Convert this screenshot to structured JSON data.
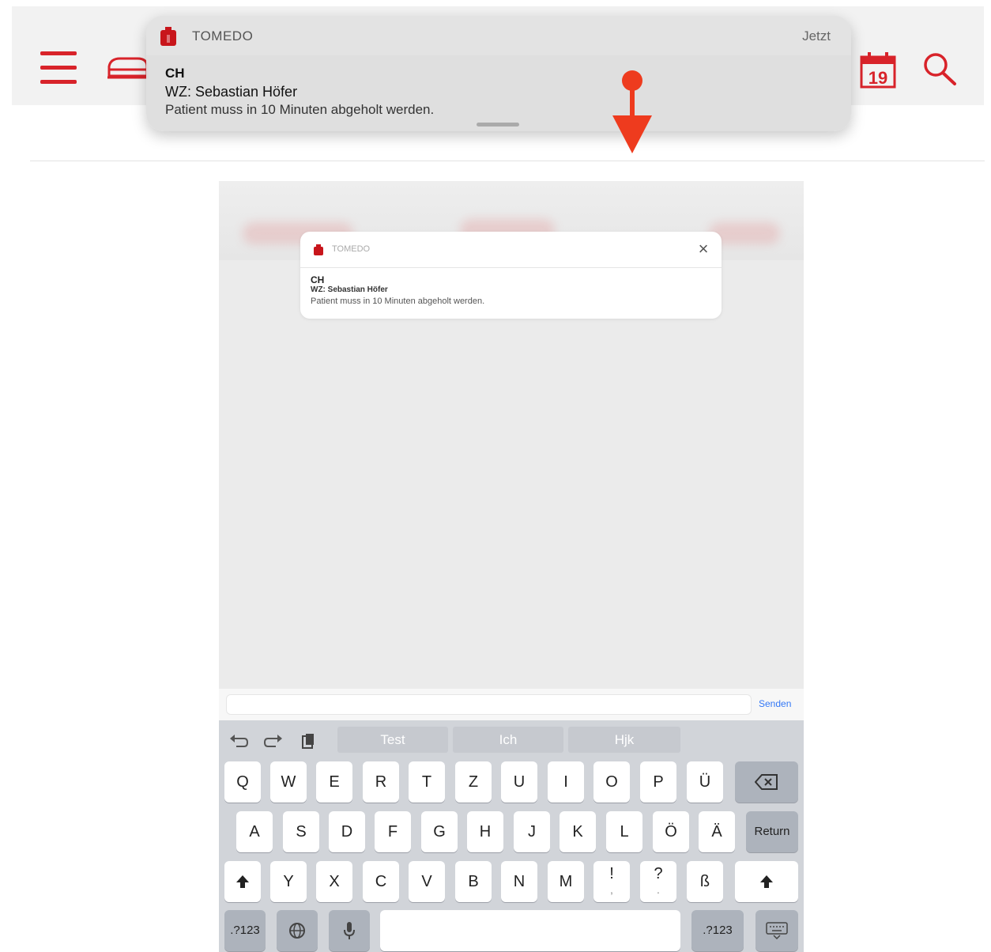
{
  "app_bar": {
    "menu_icon": "hamburger-menu-icon",
    "bed_icon": "bed-icon",
    "calendar_icon": "calendar-icon",
    "calendar_day": "19",
    "search_icon": "search-icon",
    "accent_color": "#d8232a"
  },
  "banner": {
    "app_name": "TOMEDO",
    "time": "Jetzt",
    "title": "CH",
    "subtitle": "WZ: Sebastian Höfer",
    "message": "Patient muss in 10 Minuten abgeholt werden."
  },
  "annotation": {
    "swipe_arrow_icon": "swipe-down-arrow-icon",
    "arrow_color": "#ee3b1e"
  },
  "inner_screen": {
    "notification": {
      "app_name": "TOMEDO",
      "title": "CH",
      "subtitle": "WZ: Sebastian Höfer",
      "message": "Patient muss in 10 Minuten abgeholt werden."
    },
    "compose": {
      "input_value": "",
      "send_label": "Senden"
    },
    "keyboard": {
      "suggestions": [
        "Test",
        "Ich",
        "Hjk"
      ],
      "row1": [
        "Q",
        "W",
        "E",
        "R",
        "T",
        "Z",
        "U",
        "I",
        "O",
        "P",
        "Ü"
      ],
      "row2": [
        "A",
        "S",
        "D",
        "F",
        "G",
        "H",
        "J",
        "K",
        "L",
        "Ö",
        "Ä"
      ],
      "return_label": "Return",
      "row3": [
        "Y",
        "X",
        "C",
        "V",
        "B",
        "N",
        "M",
        "!",
        "?",
        "ß"
      ],
      "row3_sub": [
        ",",
        "."
      ],
      "numbers_label": ".?123"
    }
  }
}
